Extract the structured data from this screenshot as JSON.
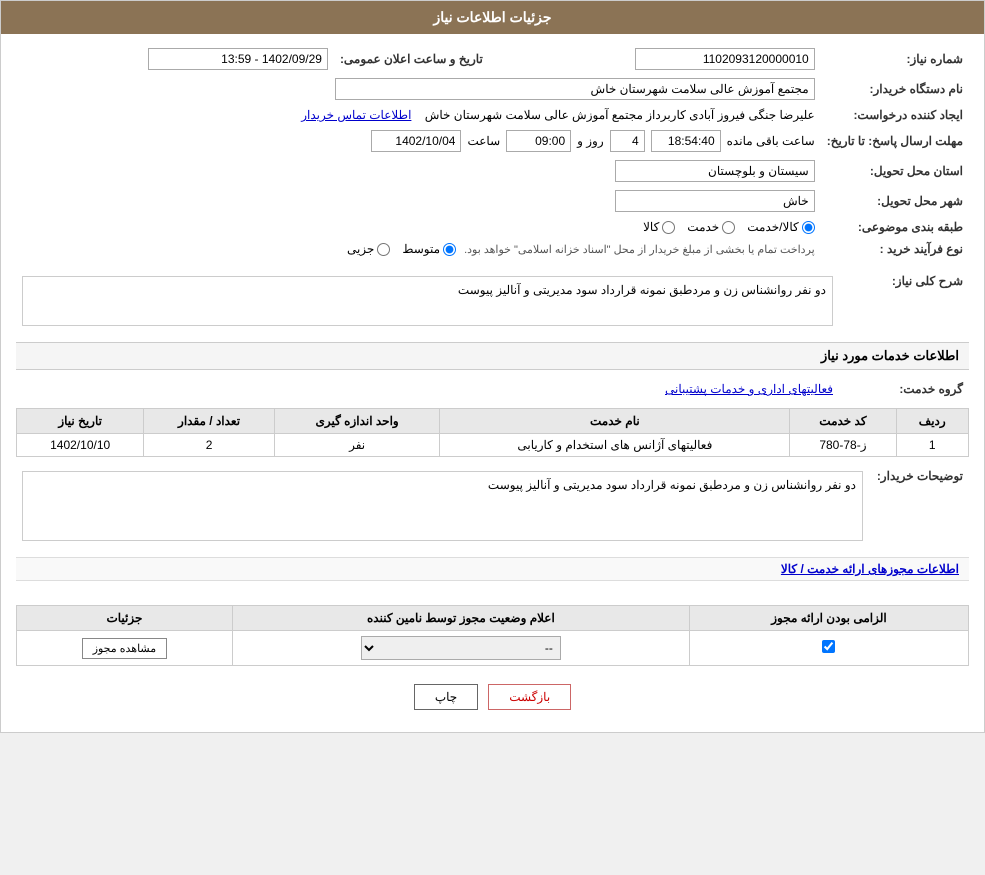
{
  "page": {
    "title": "جزئیات اطلاعات نیاز"
  },
  "header": {
    "shomareNiaz_label": "شماره نیاز:",
    "shomareNiaz_value": "1102093120000010",
    "tarikhLabel": "تاریخ و ساعت اعلان عمومی:",
    "tarikh_value": "1402/09/29 - 13:59",
    "namDastgahLabel": "نام دستگاه خریدار:",
    "namDastgah_value": "مجتمع آموزش عالی سلامت شهرستان خاش",
    "ijadKanndeLabel": "ایجاد کننده درخواست:",
    "ijadKannde_value": "علیرضا جنگی فیروز آبادی کاربرداز مجتمع آموزش عالی سلامت شهرستان خاش",
    "ettelaatLink": "اطلاعات تماس خریدار",
    "mohlatLabel": "مهلت ارسال پاسخ: تا تاریخ:",
    "mohlatDate": "1402/10/04",
    "mohlatSaatLabel": "ساعت",
    "mohlatSaat": "09:00",
    "roozLabel": "روز و",
    "roozValue": "4",
    "saatMandeSaatLabel": "ساعت باقی مانده",
    "saatMande": "18:54:40",
    "ostanLabel": "استان محل تحویل:",
    "ostan_value": "سیستان و بلوچستان",
    "shahrLabel": "شهر محل تحویل:",
    "shahr_value": "خاش",
    "tabaqeLabel": "طبقه بندی موضوعی:",
    "tabaqe_radio": [
      "کالا",
      "خدمت",
      "کالا/خدمت"
    ],
    "tabaqe_selected": "کالا/خدمت",
    "noeFarLabel": "نوع فرآیند خرید :",
    "noeFar_radio": [
      "جزیی",
      "متوسط"
    ],
    "noeFar_selected": "متوسط",
    "noeFar_note": "پرداخت تمام یا بخشی از مبلغ خریدار از محل \"اسناد خزانه اسلامی\" خواهد بود."
  },
  "sharhSection": {
    "title": "شرح کلی نیاز:",
    "text": "دو نفر روانشناس زن و مردطبق نمونه قرارداد سود مدیریتی و آنالیز پیوست"
  },
  "khadamatSection": {
    "title": "اطلاعات خدمات مورد نیاز",
    "groupLabel": "گروه خدمت:",
    "groupValue": "فعالیتهای اداری و خدمات پشتیبانی",
    "tableHeaders": [
      "ردیف",
      "کد خدمت",
      "نام خدمت",
      "واحد اندازه گیری",
      "تعداد / مقدار",
      "تاریخ نیاز"
    ],
    "tableRows": [
      {
        "radif": "1",
        "kodKhadamat": "ز-78-780",
        "namKhadamat": "فعالیتهای آژانس های استخدام و کاریابی",
        "vahed": "نفر",
        "tedad": "2",
        "tarikh": "1402/10/10"
      }
    ],
    "tazihLabel": "توضیحات خریدار:",
    "tazihText": "دو نفر روانشناس زن و مردطبق نمونه قرارداد سود مدیریتی و آنالیز پیوست"
  },
  "mojawazSection": {
    "title": "اطلاعات مجوزهای ارائه خدمت / کالا",
    "tableHeaders": [
      "الزامی بودن ارائه مجوز",
      "اعلام وضعیت مجوز توسط نامین کننده",
      "جزئیات"
    ],
    "tableRows": [
      {
        "elzami": true,
        "status": "--",
        "btn_label": "مشاهده مجوز"
      }
    ]
  },
  "footer": {
    "printBtn": "چاپ",
    "backBtn": "بازگشت"
  }
}
